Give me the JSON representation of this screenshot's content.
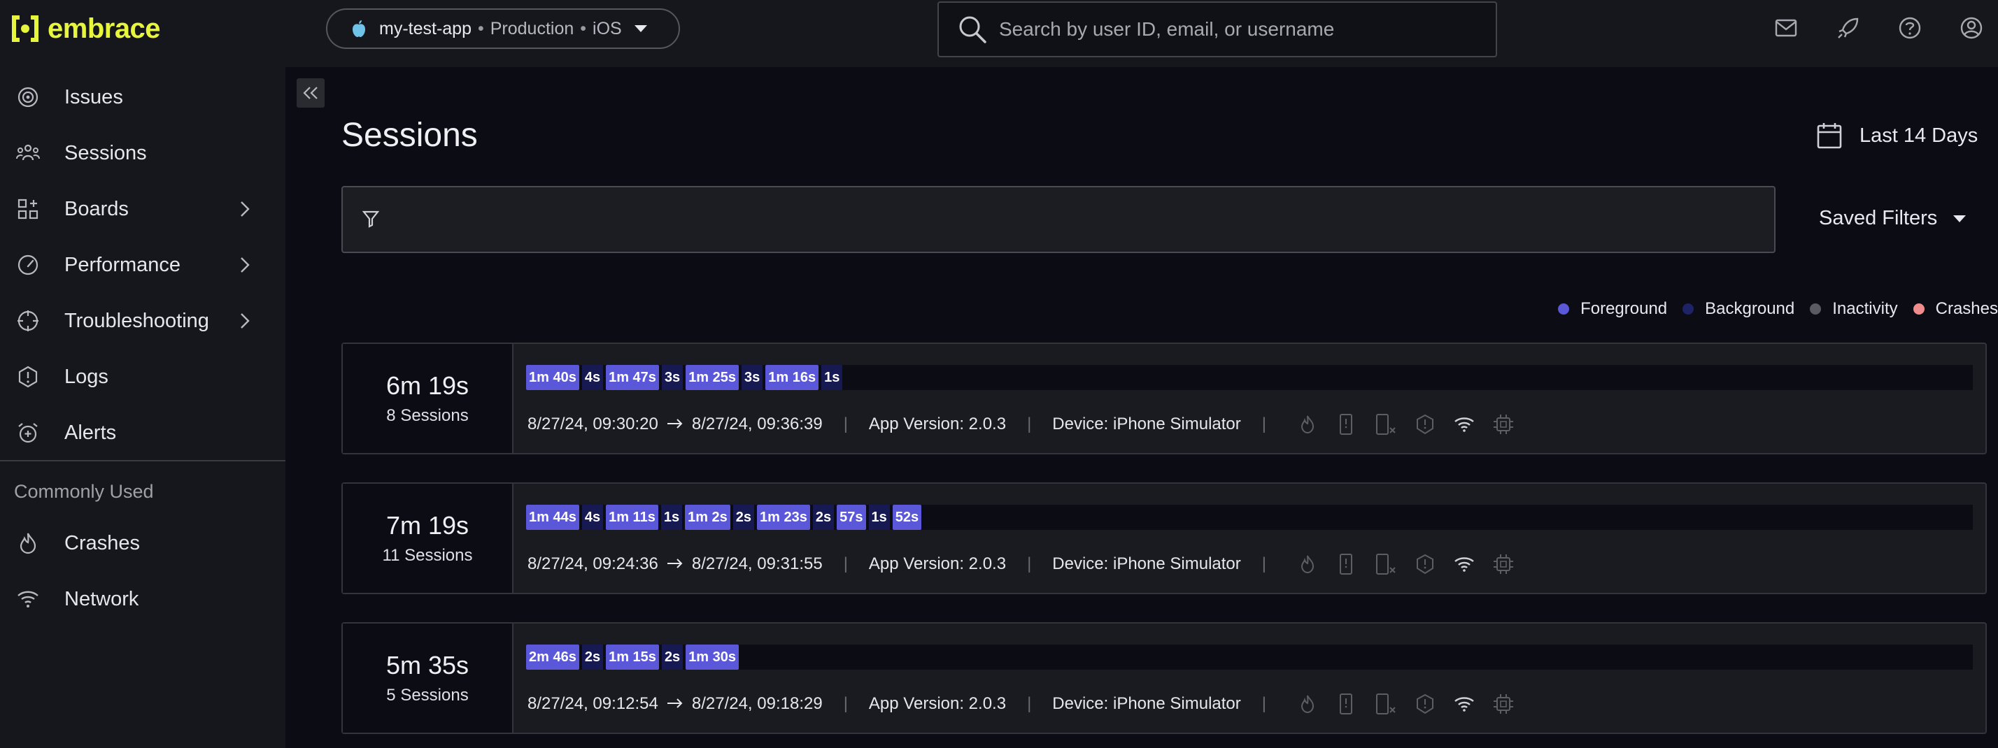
{
  "brand": {
    "name": "embrace",
    "accent": "#e7f53c"
  },
  "app_switcher": {
    "app": "my-test-app",
    "environment": "Production",
    "platform": "iOS"
  },
  "search": {
    "placeholder": "Search by user ID, email, or username"
  },
  "top_icons": [
    "mail-icon",
    "rocket-icon",
    "help-icon",
    "account-icon"
  ],
  "sidebar": {
    "items": [
      {
        "label": "Issues",
        "icon": "radar-icon",
        "has_submenu": false
      },
      {
        "label": "Sessions",
        "icon": "users-icon",
        "has_submenu": false
      },
      {
        "label": "Boards",
        "icon": "boards-icon",
        "has_submenu": true
      },
      {
        "label": "Performance",
        "icon": "gauge-icon",
        "has_submenu": true
      },
      {
        "label": "Troubleshooting",
        "icon": "crosshair-icon",
        "has_submenu": true
      },
      {
        "label": "Logs",
        "icon": "alert-hexagon-icon",
        "has_submenu": false
      },
      {
        "label": "Alerts",
        "icon": "alarm-icon",
        "has_submenu": false
      }
    ],
    "section_label": "Commonly Used",
    "common_items": [
      {
        "label": "Crashes",
        "icon": "flame-icon"
      },
      {
        "label": "Network",
        "icon": "wifi-icon"
      }
    ]
  },
  "main": {
    "title": "Sessions",
    "date_range": "Last 14 Days",
    "saved_filters": "Saved Filters",
    "legend": [
      {
        "label": "Foreground",
        "color": "#5b57d9"
      },
      {
        "label": "Background",
        "color": "#1e2266"
      },
      {
        "label": "Inactivity",
        "color": "#5a5a62"
      },
      {
        "label": "Crashes",
        "color": "#f08c8c"
      }
    ],
    "sessions": [
      {
        "duration": "6m 19s",
        "count": "8 Sessions",
        "segments": [
          {
            "label": "1m 40s",
            "kind": "fg"
          },
          {
            "label": "4s",
            "kind": "bg"
          },
          {
            "label": "1m 47s",
            "kind": "fg"
          },
          {
            "label": "3s",
            "kind": "bg"
          },
          {
            "label": "1m 25s",
            "kind": "fg"
          },
          {
            "label": "3s",
            "kind": "bg"
          },
          {
            "label": "1m 16s",
            "kind": "fg"
          },
          {
            "label": "1s",
            "kind": "bg"
          }
        ],
        "start": "8/27/24, 09:30:20",
        "end": "8/27/24, 09:36:39",
        "app_version": "App Version: 2.0.3",
        "device": "Device: iPhone Simulator"
      },
      {
        "duration": "7m 19s",
        "count": "11 Sessions",
        "segments": [
          {
            "label": "1m 44s",
            "kind": "fg"
          },
          {
            "label": "4s",
            "kind": "bg"
          },
          {
            "label": "1m 11s",
            "kind": "fg"
          },
          {
            "label": "1s",
            "kind": "bg"
          },
          {
            "label": "1m 2s",
            "kind": "fg"
          },
          {
            "label": "2s",
            "kind": "bg"
          },
          {
            "label": "1m 23s",
            "kind": "fg"
          },
          {
            "label": "2s",
            "kind": "bg"
          },
          {
            "label": "57s",
            "kind": "fg"
          },
          {
            "label": "1s",
            "kind": "bg"
          },
          {
            "label": "52s",
            "kind": "fg"
          }
        ],
        "start": "8/27/24, 09:24:36",
        "end": "8/27/24, 09:31:55",
        "app_version": "App Version: 2.0.3",
        "device": "Device: iPhone Simulator"
      },
      {
        "duration": "5m 35s",
        "count": "5 Sessions",
        "segments": [
          {
            "label": "2m 46s",
            "kind": "fg"
          },
          {
            "label": "2s",
            "kind": "bg"
          },
          {
            "label": "1m 15s",
            "kind": "fg"
          },
          {
            "label": "2s",
            "kind": "bg"
          },
          {
            "label": "1m 30s",
            "kind": "fg"
          }
        ],
        "start": "8/27/24, 09:12:54",
        "end": "8/27/24, 09:18:29",
        "app_version": "App Version: 2.0.3",
        "device": "Device: iPhone Simulator"
      }
    ],
    "session_icons": [
      "flame-icon",
      "phone-alert-icon",
      "phone-x-icon",
      "hexagon-alert-icon",
      "wifi-icon",
      "cpu-icon"
    ]
  }
}
